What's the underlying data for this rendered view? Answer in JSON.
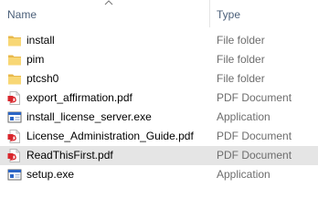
{
  "header": {
    "name_label": "Name",
    "type_label": "Type",
    "sort_icon": "sort-ascending-arrow-icon"
  },
  "files": [
    {
      "name": "install",
      "type": "File folder",
      "icon": "folder-icon"
    },
    {
      "name": "pim",
      "type": "File folder",
      "icon": "folder-icon"
    },
    {
      "name": "ptcsh0",
      "type": "File folder",
      "icon": "folder-icon"
    },
    {
      "name": "export_affirmation.pdf",
      "type": "PDF Document",
      "icon": "pdf-icon"
    },
    {
      "name": "install_license_server.exe",
      "type": "Application",
      "icon": "application-icon"
    },
    {
      "name": "License_Administration_Guide.pdf",
      "type": "PDF Document",
      "icon": "pdf-icon"
    },
    {
      "name": "ReadThisFirst.pdf",
      "type": "PDF Document",
      "icon": "pdf-icon",
      "hovered": true
    },
    {
      "name": "setup.exe",
      "type": "Application",
      "icon": "application-icon"
    }
  ],
  "colors": {
    "folder": "#f8d775",
    "pdf_red": "#d9262c",
    "app_blue": "#2b65c6",
    "hover_bg": "#e5e5e5",
    "header_text": "#4c607a",
    "type_text": "#6d6d6d"
  }
}
